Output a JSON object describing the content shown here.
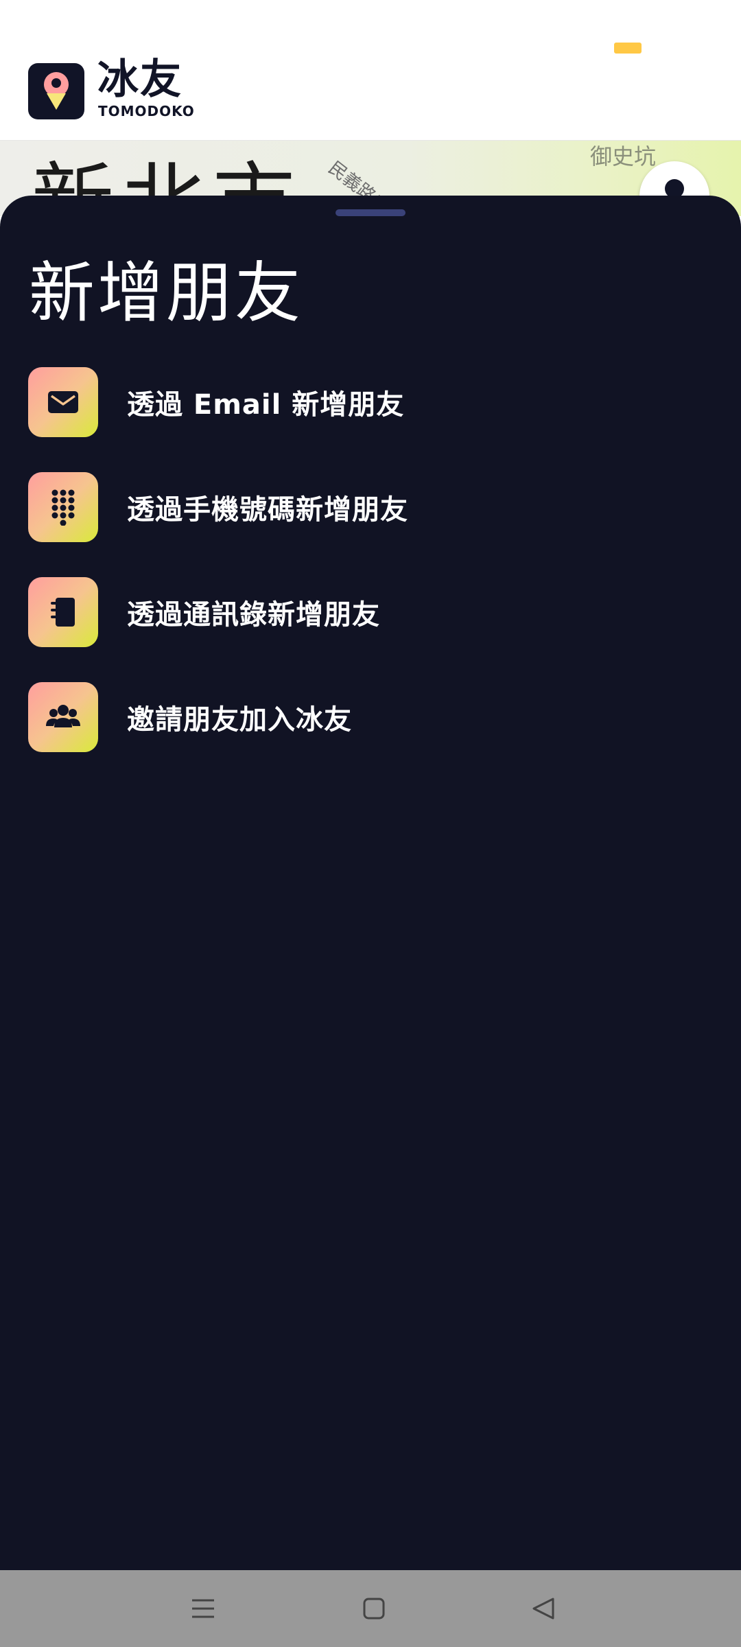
{
  "header": {
    "logo_text": "冰友",
    "logo_sub": "TOMODOKO"
  },
  "map": {
    "city_label": "新北市",
    "road_label": "民義路二段",
    "place_label": "御史坑"
  },
  "sheet": {
    "title": "新增朋友",
    "options": [
      {
        "label": "透過 Email 新增朋友",
        "icon": "envelope-icon"
      },
      {
        "label": "透過手機號碼新增朋友",
        "icon": "keypad-icon"
      },
      {
        "label": "透過通訊錄新增朋友",
        "icon": "contacts-book-icon"
      },
      {
        "label": "邀請朋友加入冰友",
        "icon": "group-icon"
      }
    ]
  },
  "navbar": {
    "buttons": [
      "menu-icon",
      "home-square-icon",
      "back-triangle-icon"
    ]
  },
  "colors": {
    "sheet_bg": "#111324",
    "icon_gradient": [
      "#ff9e9e",
      "#d9ea3a"
    ],
    "accent_pill": "#ffc845"
  }
}
